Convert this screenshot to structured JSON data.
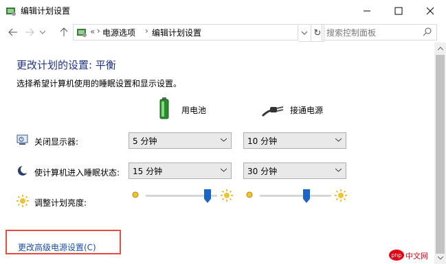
{
  "window": {
    "title": "编辑计划设置",
    "minimize_icon": "minimize-icon",
    "maximize_icon": "maximize-icon",
    "close_icon": "close-icon"
  },
  "nav": {
    "back_icon": "arrow-left-icon",
    "forward_icon": "arrow-right-icon",
    "recent_icon": "chevron-down-icon",
    "up_icon": "arrow-up-icon",
    "address_icon": "control-panel-icon",
    "overflow": "«",
    "breadcrumb": [
      "电源选项",
      "编辑计划设置"
    ],
    "refresh_icon": "refresh-icon",
    "search_placeholder": "搜索控制面板"
  },
  "main": {
    "heading": "更改计划的设置: 平衡",
    "subtext": "选择希望计算机使用的睡眠设置和显示设置。",
    "columns": [
      {
        "label": "用电池",
        "icon": "battery-icon"
      },
      {
        "label": "接通电源",
        "icon": "power-plug-icon"
      }
    ],
    "rows": [
      {
        "label": "关闭显示器:",
        "icon": "display-icon",
        "battery": "5 分钟",
        "ac": "10 分钟"
      },
      {
        "label": "使计算机进入睡眠状态:",
        "icon": "moon-icon",
        "battery": "15 分钟",
        "ac": "30 分钟"
      }
    ],
    "brightness": {
      "label": "调整计划亮度:",
      "icon": "sun-icon",
      "battery_level": 0.9,
      "ac_level": 0.67
    },
    "advanced_link": "更改高级电源设置(C)"
  },
  "colors": {
    "heading": "#1e3287",
    "link": "#1a4fa7",
    "highlight_box": "#e74c3c",
    "slider_thumb": "#1a66c7"
  },
  "watermark": "php中文网"
}
